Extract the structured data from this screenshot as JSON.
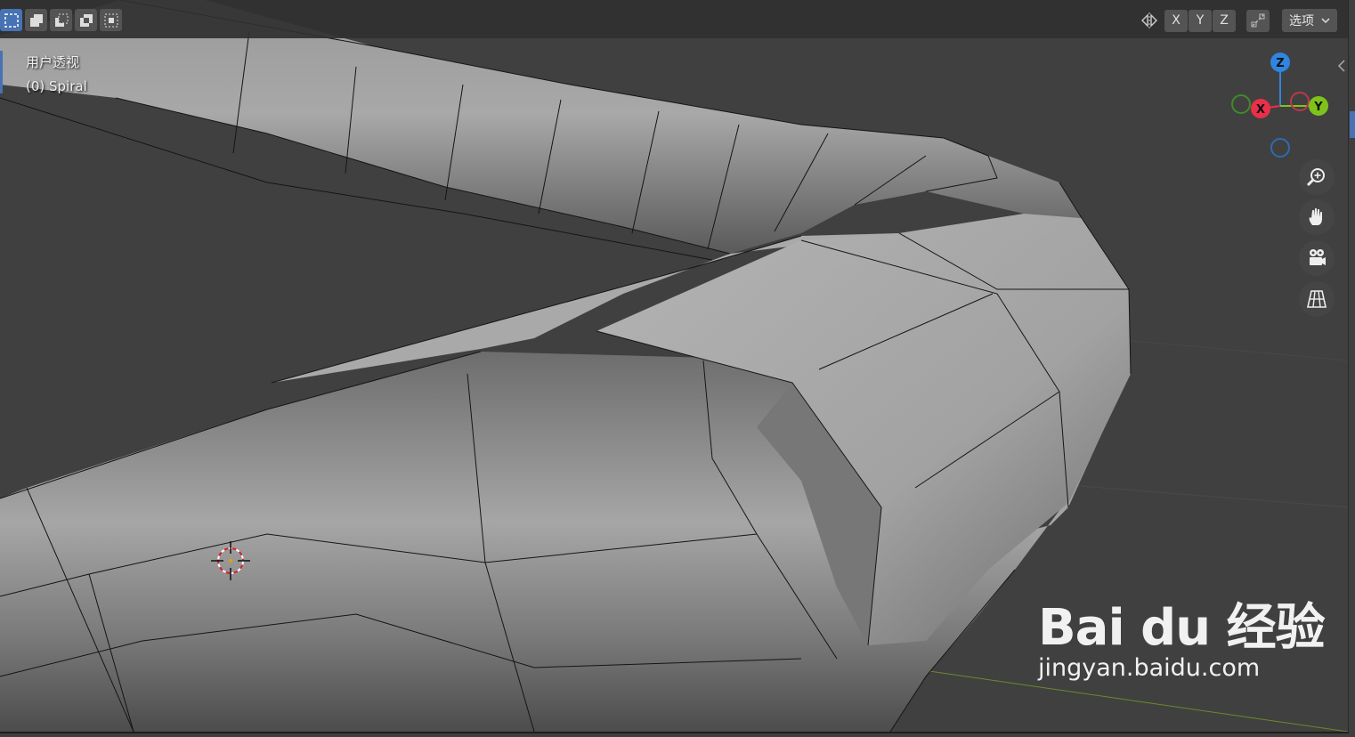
{
  "header": {
    "selection_modes": [
      {
        "name": "select-new-icon",
        "active": true
      },
      {
        "name": "select-extend-icon",
        "active": false
      },
      {
        "name": "select-subtract-icon",
        "active": false
      },
      {
        "name": "select-difference-icon",
        "active": false
      },
      {
        "name": "select-intersect-icon",
        "active": false
      }
    ],
    "mirror_icon": "mirror-axis-icon",
    "axes": [
      "X",
      "Y",
      "Z"
    ],
    "snap_icon": "snap-icon",
    "options_label": "选项"
  },
  "viewport": {
    "view_name": "用户透视",
    "object_label": "(0) Spiral"
  },
  "gizmo": {
    "z_label": "Z",
    "x_label": "X",
    "y_label": "Y",
    "colors": {
      "x": "#e8304a",
      "y": "#7fc31a",
      "z": "#2f85e0",
      "neg_x": "#3f8a2a",
      "neg_y": "#b83a48",
      "neg_z": "#2f6bb0"
    }
  },
  "nav_buttons": [
    "zoom-icon",
    "pan-hand-icon",
    "camera-icon",
    "grid-ortho-icon"
  ],
  "watermark": {
    "brand": "Bai du 经验",
    "url": "jingyan.baidu.com"
  }
}
